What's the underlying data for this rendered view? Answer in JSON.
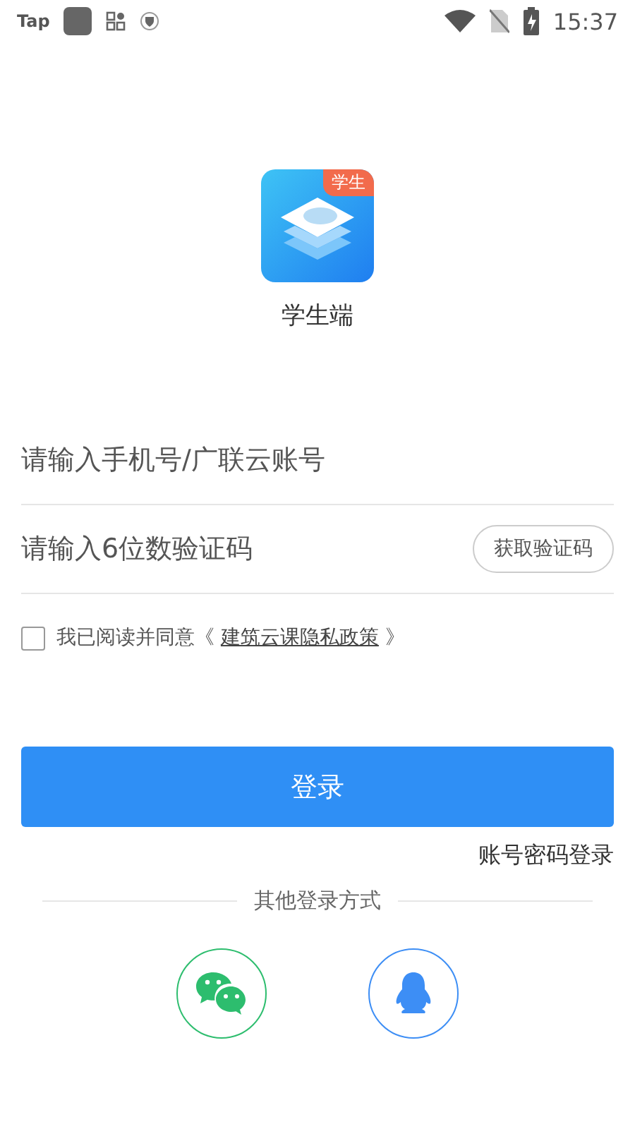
{
  "status_bar": {
    "carrier": "Tap",
    "time": "15:37"
  },
  "app": {
    "badge": "学生",
    "name": "学生端"
  },
  "phone_field": {
    "placeholder": "请输入手机号/广联云账号"
  },
  "code_field": {
    "placeholder": "请输入6位数验证码",
    "button": "获取验证码"
  },
  "agreement": {
    "checked": false,
    "prefix": "我已阅读并同意《 ",
    "link": "建筑云课隐私政策",
    "suffix": " 》"
  },
  "login_button": "登录",
  "password_login": "账号密码登录",
  "other_login": {
    "title": "其他登录方式",
    "options": [
      {
        "kind": "wechat"
      },
      {
        "kind": "qq"
      }
    ]
  }
}
